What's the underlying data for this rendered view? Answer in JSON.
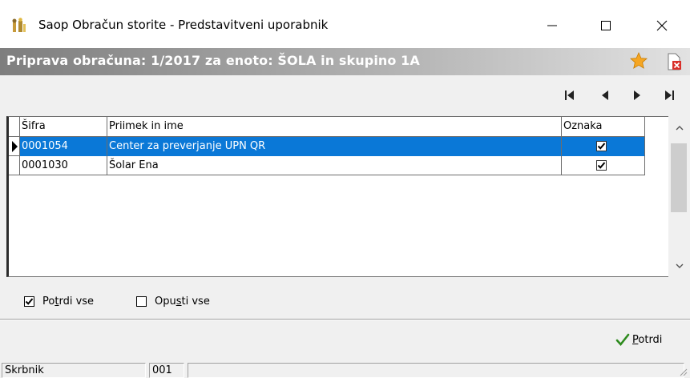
{
  "window": {
    "title": "Saop Obračun storite - Predstavitveni uporabnik"
  },
  "banner": {
    "title": "Priprava obračuna: 1/2017 za enoto: ŠOLA in skupino 1A"
  },
  "grid": {
    "columns": [
      "Šifra",
      "Priimek in ime",
      "Oznaka"
    ],
    "rows": [
      {
        "code": "0001054",
        "name": "Center za preverjanje UPN QR",
        "checked": true,
        "selected": true
      },
      {
        "code": "0001030",
        "name": "Šolar Ena",
        "checked": true,
        "selected": false
      }
    ]
  },
  "options": {
    "confirm_all": {
      "label_pre": "Po",
      "label_u": "t",
      "label_post": "rdi vse",
      "checked": true
    },
    "skip_all": {
      "label_pre": "Opu",
      "label_u": "s",
      "label_post": "ti vse",
      "checked": false
    }
  },
  "actions": {
    "confirm_pre": "",
    "confirm_u": "P",
    "confirm_post": "otrdi"
  },
  "status": {
    "panel1": "Skrbnik",
    "panel2": "001",
    "panel3": ""
  },
  "icons": {
    "app": "app-people-icon",
    "favorite": "star-icon",
    "delete": "delete-document-icon",
    "nav_first": "first-record-icon",
    "nav_prev": "previous-record-icon",
    "nav_next": "next-record-icon",
    "nav_last": "last-record-icon",
    "confirm": "checkmark-icon"
  },
  "colors": {
    "selection": "#0a78d7",
    "star": "#f5a623",
    "confirm_check": "#2e8b1e"
  }
}
